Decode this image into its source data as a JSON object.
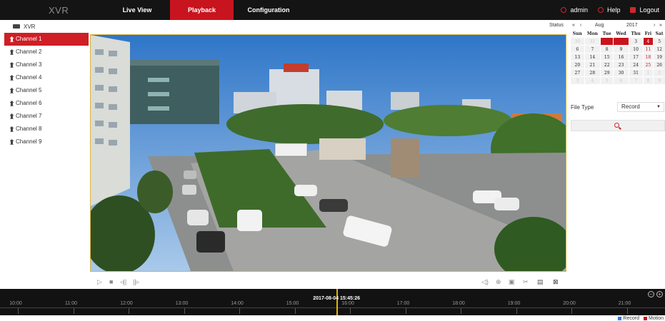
{
  "topbar": {
    "brand": "XVR",
    "tabs": [
      {
        "label": "Live View",
        "active": false
      },
      {
        "label": "Playback",
        "active": true
      },
      {
        "label": "Configuration",
        "active": false
      }
    ],
    "user": "admin",
    "help": "Help",
    "logout": "Logout",
    "accent_color": "#c8141e"
  },
  "device": {
    "label": "XVR",
    "icon": "dvr-icon"
  },
  "status_label": "Status",
  "channels": [
    {
      "label": "Channel 1",
      "selected": true
    },
    {
      "label": "Channel 2",
      "selected": false
    },
    {
      "label": "Channel 3",
      "selected": false
    },
    {
      "label": "Channel 4",
      "selected": false
    },
    {
      "label": "Channel 5",
      "selected": false
    },
    {
      "label": "Channel 6",
      "selected": false
    },
    {
      "label": "Channel 7",
      "selected": false
    },
    {
      "label": "Channel 8",
      "selected": false
    },
    {
      "label": "Channel 9",
      "selected": false
    }
  ],
  "calendar": {
    "month": "Aug",
    "year": "2017",
    "nav": {
      "prev_year": "«",
      "prev_month": "‹",
      "next_month": "›",
      "next_year": "»"
    },
    "weekdays": [
      "Sun",
      "Mon",
      "Tue",
      "Wed",
      "Thu",
      "Fri",
      "Sat"
    ],
    "weeks": [
      [
        "30",
        "31",
        "1",
        "2",
        "3",
        "4",
        "5"
      ],
      [
        "6",
        "7",
        "8",
        "9",
        "10",
        "11",
        "12"
      ],
      [
        "13",
        "14",
        "15",
        "16",
        "17",
        "18",
        "19"
      ],
      [
        "20",
        "21",
        "22",
        "23",
        "24",
        "25",
        "26"
      ],
      [
        "27",
        "28",
        "29",
        "30",
        "31",
        "1",
        "2"
      ],
      [
        "3",
        "4",
        "5",
        "6",
        "7",
        "8",
        "9"
      ]
    ],
    "record_days": [
      "1",
      "2"
    ],
    "selected_day": "4"
  },
  "file_type": {
    "label": "File Type",
    "value": "Record"
  },
  "search": {
    "icon": "search-icon"
  },
  "controls": [
    "play-icon",
    "stop-icon",
    "slow-icon",
    "fast-icon",
    "volume-icon",
    "zoom-icon",
    "snapshot-icon",
    "clip-icon",
    "save-icon",
    "fullscreen-icon"
  ],
  "timeline": {
    "labels": [
      "10:00",
      "11:00",
      "12:00",
      "13:00",
      "14:00",
      "15:00",
      "16:00",
      "17:00",
      "18:00",
      "19:00",
      "20:00",
      "21:00"
    ],
    "current": "2017-08-04 15:45:26",
    "current_hour": 15.757
  },
  "legend": [
    {
      "label": "Record",
      "color": "#3a7ad6"
    },
    {
      "label": "Motion",
      "color": "#c8141e"
    }
  ]
}
